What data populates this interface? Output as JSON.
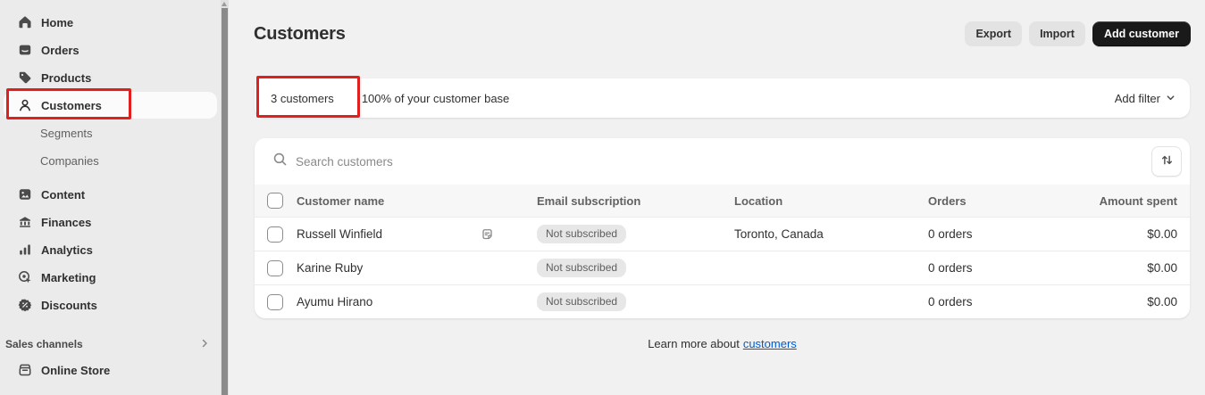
{
  "sidebar": {
    "items": [
      {
        "label": "Home"
      },
      {
        "label": "Orders"
      },
      {
        "label": "Products"
      },
      {
        "label": "Customers",
        "active": true
      },
      {
        "label": "Segments",
        "sub": true
      },
      {
        "label": "Companies",
        "sub": true
      },
      {
        "label": "Content"
      },
      {
        "label": "Finances"
      },
      {
        "label": "Analytics"
      },
      {
        "label": "Marketing"
      },
      {
        "label": "Discounts"
      }
    ],
    "sales_channels_label": "Sales channels",
    "online_store_label": "Online Store"
  },
  "header": {
    "title": "Customers",
    "buttons": {
      "export": "Export",
      "import": "Import",
      "add_customer": "Add customer"
    }
  },
  "filter_bar": {
    "count_label": "3 customers",
    "summary": "100% of your customer base",
    "add_filter_label": "Add filter"
  },
  "search": {
    "placeholder": "Search customers"
  },
  "table": {
    "headers": [
      "Customer name",
      "Email subscription",
      "Location",
      "Orders",
      "Amount spent"
    ],
    "rows": [
      {
        "name": "Russell Winfield",
        "has_note": true,
        "email_subscription": "Not subscribed",
        "location": "Toronto, Canada",
        "orders": "0 orders",
        "amount_spent": "$0.00"
      },
      {
        "name": "Karine Ruby",
        "has_note": false,
        "email_subscription": "Not subscribed",
        "location": "",
        "orders": "0 orders",
        "amount_spent": "$0.00"
      },
      {
        "name": "Ayumu Hirano",
        "has_note": false,
        "email_subscription": "Not subscribed",
        "location": "",
        "orders": "0 orders",
        "amount_spent": "$0.00"
      }
    ]
  },
  "footer": {
    "prefix": "Learn more about",
    "link_text": "customers"
  },
  "icons": {
    "home": "house",
    "orders": "box",
    "products": "tag",
    "customers": "person",
    "content": "media",
    "finances": "bank",
    "analytics": "bar-chart",
    "marketing": "target-cursor",
    "discounts": "percent-badge",
    "online_store": "storefront",
    "sales_channels_chevron": "chevron-right",
    "add_filter_chevron": "chevron-down",
    "search": "magnifier",
    "sort": "arrows-up-down",
    "note": "note",
    "scroll_up": "triangle-up"
  },
  "colors": {
    "annotation_red": "#e01f1f",
    "link_blue": "#005bd3",
    "primary_button_bg": "#1a1a1a",
    "badge_bg": "#e7e7e7",
    "sidebar_bg": "#ebebeb",
    "main_bg": "#f1f1f1"
  }
}
